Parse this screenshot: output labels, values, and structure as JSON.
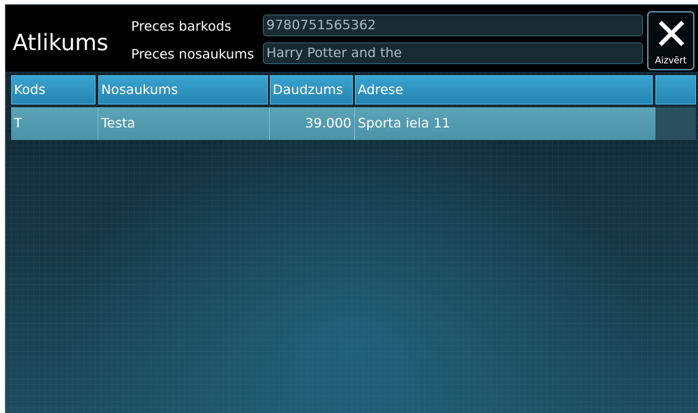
{
  "header": {
    "title": "Atlikums",
    "barcode_label": "Preces barkods",
    "barcode_value": "9780751565362",
    "name_label": "Preces nosaukums",
    "name_value": "Harry Potter and the",
    "close_label": "Aizvērt",
    "close_icon": "close-icon"
  },
  "table": {
    "columns": [
      "Kods",
      "Nosaukums",
      "Daudzums",
      "Adrese",
      ""
    ],
    "rows": [
      {
        "kods": "T",
        "nosaukums": "Testa",
        "daudzums": "39.000",
        "adrese": "Sporta iela 11"
      }
    ]
  },
  "colors": {
    "header_bg": "#000000",
    "column_header": "#2f95c4",
    "selected_row": "#529aad",
    "grid_bg": "#163947"
  }
}
